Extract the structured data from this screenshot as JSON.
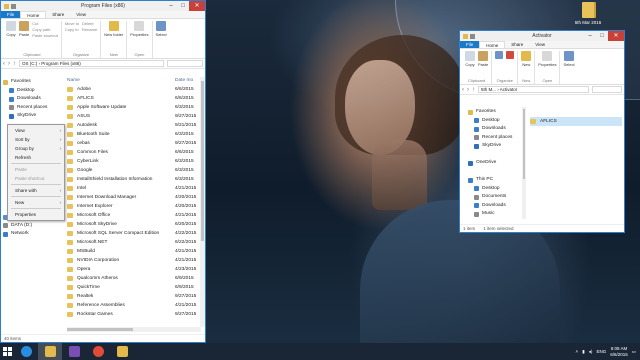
{
  "desktop": {
    "icon_label": "5th Mar 2016"
  },
  "left_window": {
    "title": "Program Files (x86)",
    "tabs": [
      "File",
      "Home",
      "Share",
      "View"
    ],
    "ribbon": {
      "clipboard_label": "Clipboard",
      "copy": "Copy",
      "paste": "Paste",
      "cut": "Cut",
      "copy_path": "Copy path",
      "paste_shortcut": "Paste shortcut",
      "move_to": "Move to",
      "copy_to": "Copy to",
      "organize_label": "Organize",
      "delete": "Delete",
      "rename": "Rename",
      "new_label": "New",
      "new_folder": "New folder",
      "open_label": "Open",
      "properties": "Properties",
      "select": "Select"
    },
    "address": "OS (C:) › Program Files (x86)",
    "nav_pane": [
      {
        "label": "Favorites",
        "icon": "star-icon",
        "color": "#e3b94b"
      },
      {
        "label": "Desktop",
        "icon": "desktop-icon",
        "color": "#3b7fc9"
      },
      {
        "label": "Downloads",
        "icon": "downloads-icon",
        "color": "#3b7fc9"
      },
      {
        "label": "Recent places",
        "icon": "recent-icon",
        "color": "#8a8a8a"
      },
      {
        "label": "SkyDrive",
        "icon": "cloud-icon",
        "color": "#2e6fb7"
      }
    ],
    "nav_pane_lower": [
      {
        "label": "OS (C:)",
        "icon": "drive-icon",
        "color": "#5d8fc7"
      },
      {
        "label": "DATA (D:)",
        "icon": "drive-icon",
        "color": "#8a8a8a"
      },
      {
        "label": "Network",
        "icon": "network-icon",
        "color": "#3b7fc9"
      }
    ],
    "columns": {
      "name": "Name",
      "date": "Date mo"
    },
    "files": [
      {
        "name": "Adobe",
        "date": "6/6/2015"
      },
      {
        "name": "AFLICS",
        "date": "6/6/2015"
      },
      {
        "name": "Apple Software Update",
        "date": "6/3/2015"
      },
      {
        "name": "ASUS",
        "date": "9/27/2015"
      },
      {
        "name": "Autodesk",
        "date": "9/21/2015"
      },
      {
        "name": "Bluetooth Suite",
        "date": "6/3/2015"
      },
      {
        "name": "cebas",
        "date": "9/27/2015"
      },
      {
        "name": "Common Files",
        "date": "6/6/2015"
      },
      {
        "name": "CyberLink",
        "date": "6/3/2015"
      },
      {
        "name": "Google",
        "date": "6/3/2015"
      },
      {
        "name": "InstallShield Installation Information",
        "date": "6/3/2015"
      },
      {
        "name": "Intel",
        "date": "4/21/2015"
      },
      {
        "name": "Internet Download Manager",
        "date": "4/20/2015"
      },
      {
        "name": "Internet Explorer",
        "date": "4/20/2015"
      },
      {
        "name": "Microsoft Office",
        "date": "4/21/2015"
      },
      {
        "name": "Microsoft SkyDrive",
        "date": "6/20/2015"
      },
      {
        "name": "Microsoft SQL Server Compact Edition",
        "date": "4/22/2015"
      },
      {
        "name": "Microsoft.NET",
        "date": "6/22/2015"
      },
      {
        "name": "MSBuild",
        "date": "4/21/2015"
      },
      {
        "name": "NVIDIA Corporation",
        "date": "4/21/2015"
      },
      {
        "name": "Opera",
        "date": "4/23/2015"
      },
      {
        "name": "Qualcomm Atheros",
        "date": "6/9/2015"
      },
      {
        "name": "QuickTime",
        "date": "6/9/2015"
      },
      {
        "name": "Realtek",
        "date": "9/27/2015"
      },
      {
        "name": "Reference Assemblies",
        "date": "4/21/2015"
      },
      {
        "name": "Rockstar Games",
        "date": "9/27/2015"
      }
    ],
    "context_menu": [
      {
        "label": "View",
        "arrow": true
      },
      {
        "label": "Sort by",
        "arrow": true
      },
      {
        "label": "Group by",
        "arrow": true
      },
      {
        "label": "Refresh"
      },
      {
        "sep": true
      },
      {
        "label": "Paste",
        "disabled": true
      },
      {
        "label": "Paste shortcut",
        "disabled": true
      },
      {
        "sep": true
      },
      {
        "label": "Share with",
        "arrow": true
      },
      {
        "sep": true
      },
      {
        "label": "New",
        "arrow": true
      },
      {
        "sep": true
      },
      {
        "label": "Properties"
      }
    ],
    "status": "40 items"
  },
  "right_window": {
    "title": "Activator",
    "tabs": [
      "File",
      "Home",
      "Share",
      "View"
    ],
    "ribbon": {
      "clipboard_label": "Clipboard",
      "copy": "Copy",
      "paste": "Paste",
      "organize_label": "Organize",
      "new_label": "New",
      "new": "New",
      "open_label": "Open",
      "properties": "Properties",
      "select": "Select"
    },
    "address": "5th M... › Activator",
    "nav_pane": [
      {
        "label": "Favorites",
        "icon": "star-icon",
        "color": "#e3b94b"
      },
      {
        "label": "Desktop",
        "icon": "desktop-icon",
        "color": "#3b7fc9"
      },
      {
        "label": "Downloads",
        "icon": "downloads-icon",
        "color": "#3b7fc9"
      },
      {
        "label": "Recent places",
        "icon": "recent-icon",
        "color": "#8a8a8a"
      },
      {
        "label": "SkyDrive",
        "icon": "cloud-icon",
        "color": "#2e6fb7"
      },
      {
        "label": "",
        "icon": "",
        "color": ""
      },
      {
        "label": "OneDrive",
        "icon": "cloud-icon",
        "color": "#2e6fb7"
      },
      {
        "label": "",
        "icon": "",
        "color": ""
      },
      {
        "label": "This PC",
        "icon": "pc-icon",
        "color": "#3b7fc9"
      },
      {
        "label": "Desktop",
        "icon": "desktop-icon",
        "color": "#3b7fc9"
      },
      {
        "label": "Documents",
        "icon": "documents-icon",
        "color": "#8a8a8a"
      },
      {
        "label": "Downloads",
        "icon": "downloads-icon",
        "color": "#3b7fc9"
      },
      {
        "label": "Music",
        "icon": "music-icon",
        "color": "#8a8a8a"
      }
    ],
    "files": [
      {
        "name": "AFLICS"
      }
    ],
    "status_items": "1 item",
    "status_selected": "1 item selected"
  },
  "taskbar": {
    "apps": [
      {
        "icon": "ie-icon",
        "color": "#2a8de0",
        "active": false
      },
      {
        "icon": "explorer-icon",
        "color": "#e3b94b",
        "active": true
      },
      {
        "icon": "mail-icon",
        "color": "#7a4fb5",
        "active": false
      },
      {
        "icon": "chrome-icon",
        "color": "#e24b3a",
        "active": false
      },
      {
        "icon": "app-icon",
        "color": "#e3b94b",
        "active": false
      }
    ],
    "lang": "ENG",
    "time": "6:08 AM",
    "date": "6/6/2015"
  }
}
